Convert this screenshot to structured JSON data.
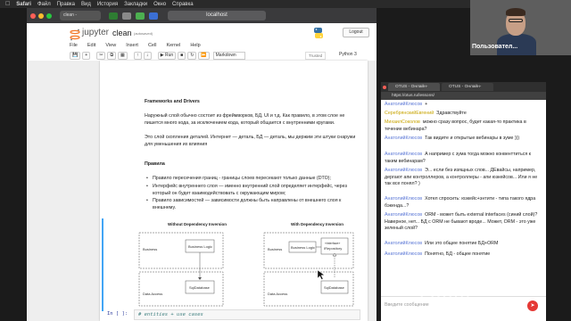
{
  "menubar": {
    "apple": "",
    "items": [
      "Safari",
      "Файл",
      "Правка",
      "Вид",
      "История",
      "Закладки",
      "Окно",
      "Справка"
    ]
  },
  "browser": {
    "tab_label": "clean -",
    "url": "localhost"
  },
  "jupyter": {
    "brand": "jupyter",
    "notebook_title": "clean",
    "autosave": "(autosaved)",
    "logout": "Logout",
    "menu": [
      "File",
      "Edit",
      "View",
      "Insert",
      "Cell",
      "Kernel",
      "Help"
    ],
    "trusted": "Trusted",
    "kernel": "Python 3",
    "run_label": "Run",
    "cell_type": "Markdown"
  },
  "notebook": {
    "h1": "Frameworks and Drivers",
    "p1": "Наружный слой обычно состоит из фреймворков, БД, UI и т.д. Как правило, в этом слое не пишется много кода, за исключением кода, который общается с внутренними кругами.",
    "p2": "Это слой скопления деталей. Интернет — деталь, БД — деталь, мы держим эти штуки снаружи для уменьшения их влияния",
    "h2": "Правила",
    "bullets": [
      "Правило пересечения границ - границы слоев пересекают только данные (DTO);",
      "Интерфейс внутреннего слоя — именно внутренний слой определяет интерфейс, через который он будет взаимодействовать с окружающим миром;",
      "Правило зависимостей — зависимости должны быть направлены от внешнего слоя к внешнему."
    ],
    "diagram": {
      "left_title": "Without Dependency Inversion",
      "right_title": "With Dependency Inversion",
      "business": "Business",
      "business_logic": "Business Logic",
      "data_access": "Data Access",
      "sql_database": "SqlDatabase",
      "interface_stereo": "«interface»",
      "repository": "IRepository"
    },
    "prompt": "In [ ]:",
    "code": "# entities + use cases"
  },
  "chat": {
    "tabs": [
      "OTUS - Онлайн-",
      "OTUS - Онлайн-"
    ],
    "url": "https://otus.ru/lessons/",
    "messages": [
      {
        "name": "АнатолийКлюсов",
        "text": "+"
      },
      {
        "name": "СеребрянскийЕвгений",
        "text": "Здравствуйте"
      },
      {
        "name": "МихаилСоколов",
        "text": "можно сразу вопрос, будет какая-то практика в течение вебинара?"
      },
      {
        "name": "АнатолийКлюсов",
        "text": "Так видите и открытые вебинары в зуме )))"
      },
      {
        "name": "АнатолийКлюсов",
        "text": "А например с зума тогда можно конвенттиться к таким вебинарам?"
      },
      {
        "name": "АнатолийКлюсов",
        "text": "Э... если без изящных слов... ДЕвайсы, например, дергают апи контроллеров, а контроллеры - апи юзкейсов... Или я не так все понял? )"
      },
      {
        "name": "АнатолийКлюсов",
        "text": "Хотел спросить: юзкейс+энтити - типа такого ядра бэкенда...?"
      },
      {
        "name": "АнатолийКлюсов",
        "text": "ORM - может быть external interfaces (синий слой)? Наверное, нет... БД с ORM не бывают вроде... Может, ORM - это уже зеленый слой?"
      },
      {
        "name": "АнатолийКлюсов",
        "text": "Или это общее понятие БД+ORM"
      },
      {
        "name": "АнатолийКлюсов",
        "text": "Понятно, БД - общее понятие"
      }
    ],
    "input_placeholder": "Введите сообщение"
  },
  "video": {
    "participant": "Пользовател..."
  },
  "watermark": "zoom",
  "colors": {
    "accent_blue": "#42a5f5",
    "chat_name": "#5a77d6",
    "send": "#e53935"
  }
}
